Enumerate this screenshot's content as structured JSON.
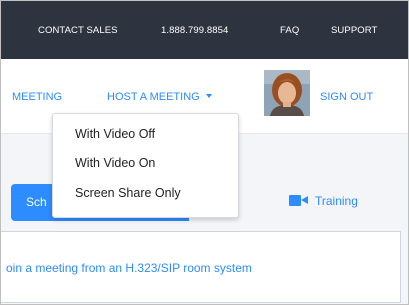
{
  "topbar": {
    "contact_sales": "CONTACT SALES",
    "phone": "1.888.799.8854",
    "faq": "FAQ",
    "support": "SUPPORT"
  },
  "nav": {
    "meeting": "MEETING",
    "host_meeting": "HOST A MEETING",
    "sign_out": "SIGN OUT"
  },
  "host_menu": {
    "items": [
      "With Video Off",
      "With Video On",
      "Screen Share Only"
    ]
  },
  "main": {
    "schedule_button": "Sch",
    "training": "Training",
    "join_text": "oin a meeting from an H.323/SIP room system"
  },
  "colors": {
    "accent": "#2d8cff",
    "topbar_bg": "#2e3340"
  },
  "icons": {
    "host_caret": "chevron-down-icon",
    "training": "video-camera-icon"
  }
}
